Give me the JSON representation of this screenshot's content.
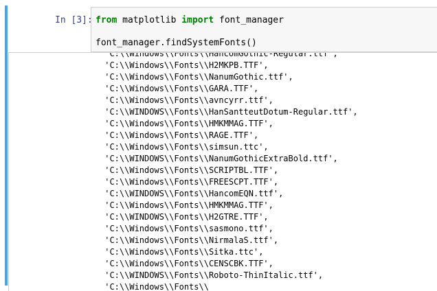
{
  "cell": {
    "prompt": "In [3]:",
    "code": {
      "line1": {
        "kw1": "from",
        "mod": " matplotlib ",
        "kw2": "import",
        "name": " font_manager"
      },
      "line2": "font_manager.findSystemFonts()"
    }
  },
  "colors": {
    "prompt": "#303f9f",
    "keyword": "#008000",
    "selection_bar": "#42a5f5",
    "input_bg": "#f7f7f7"
  },
  "output": {
    "lines": [
      " 'C:\\\\Windows\\\\Fonts\\\\HancomGothic-Regular.ttf',",
      " 'C:\\\\Windows\\\\Fonts\\\\H2MKPB.TTF',",
      " 'C:\\\\Windows\\\\Fonts\\\\NanumGothic.ttf',",
      " 'C:\\\\Windows\\\\Fonts\\\\GARA.TTF',",
      " 'C:\\\\Windows\\\\Fonts\\\\avncyrr.ttf',",
      " 'C:\\\\WINDOWS\\\\Fonts\\\\HanSantteutDotum-Regular.ttf',",
      " 'C:\\\\Windows\\\\Fonts\\\\HMKMMAG.TTF',",
      " 'C:\\\\Windows\\\\Fonts\\\\RAGE.TTF',",
      " 'C:\\\\Windows\\\\Fonts\\\\simsun.ttc',",
      " 'C:\\\\WINDOWS\\\\Fonts\\\\NanumGothicExtraBold.ttf',",
      " 'C:\\\\Windows\\\\Fonts\\\\SCRIPTBL.TTF',",
      " 'C:\\\\Windows\\\\Fonts\\\\FREESCPT.TTF',",
      " 'C:\\\\WINDOWS\\\\Fonts\\\\HancomEQN.ttf',",
      " 'C:\\\\Windows\\\\Fonts\\\\HMKMMAG.TTF',",
      " 'C:\\\\WINDOWS\\\\Fonts\\\\H2GTRE.TTF',",
      " 'C:\\\\Windows\\\\Fonts\\\\sasmono.ttf',",
      " 'C:\\\\Windows\\\\Fonts\\\\NirmalaS.ttf',",
      " 'C:\\\\Windows\\\\Fonts\\\\Sitka.ttc',",
      " 'C:\\\\Windows\\\\Fonts\\\\CENSCBK.TTF',",
      " 'C:\\\\WINDOWS\\\\Fonts\\\\Roboto-ThinItalic.ttf',",
      " 'C:\\\\Windows\\\\Fonts\\\\"
    ]
  }
}
